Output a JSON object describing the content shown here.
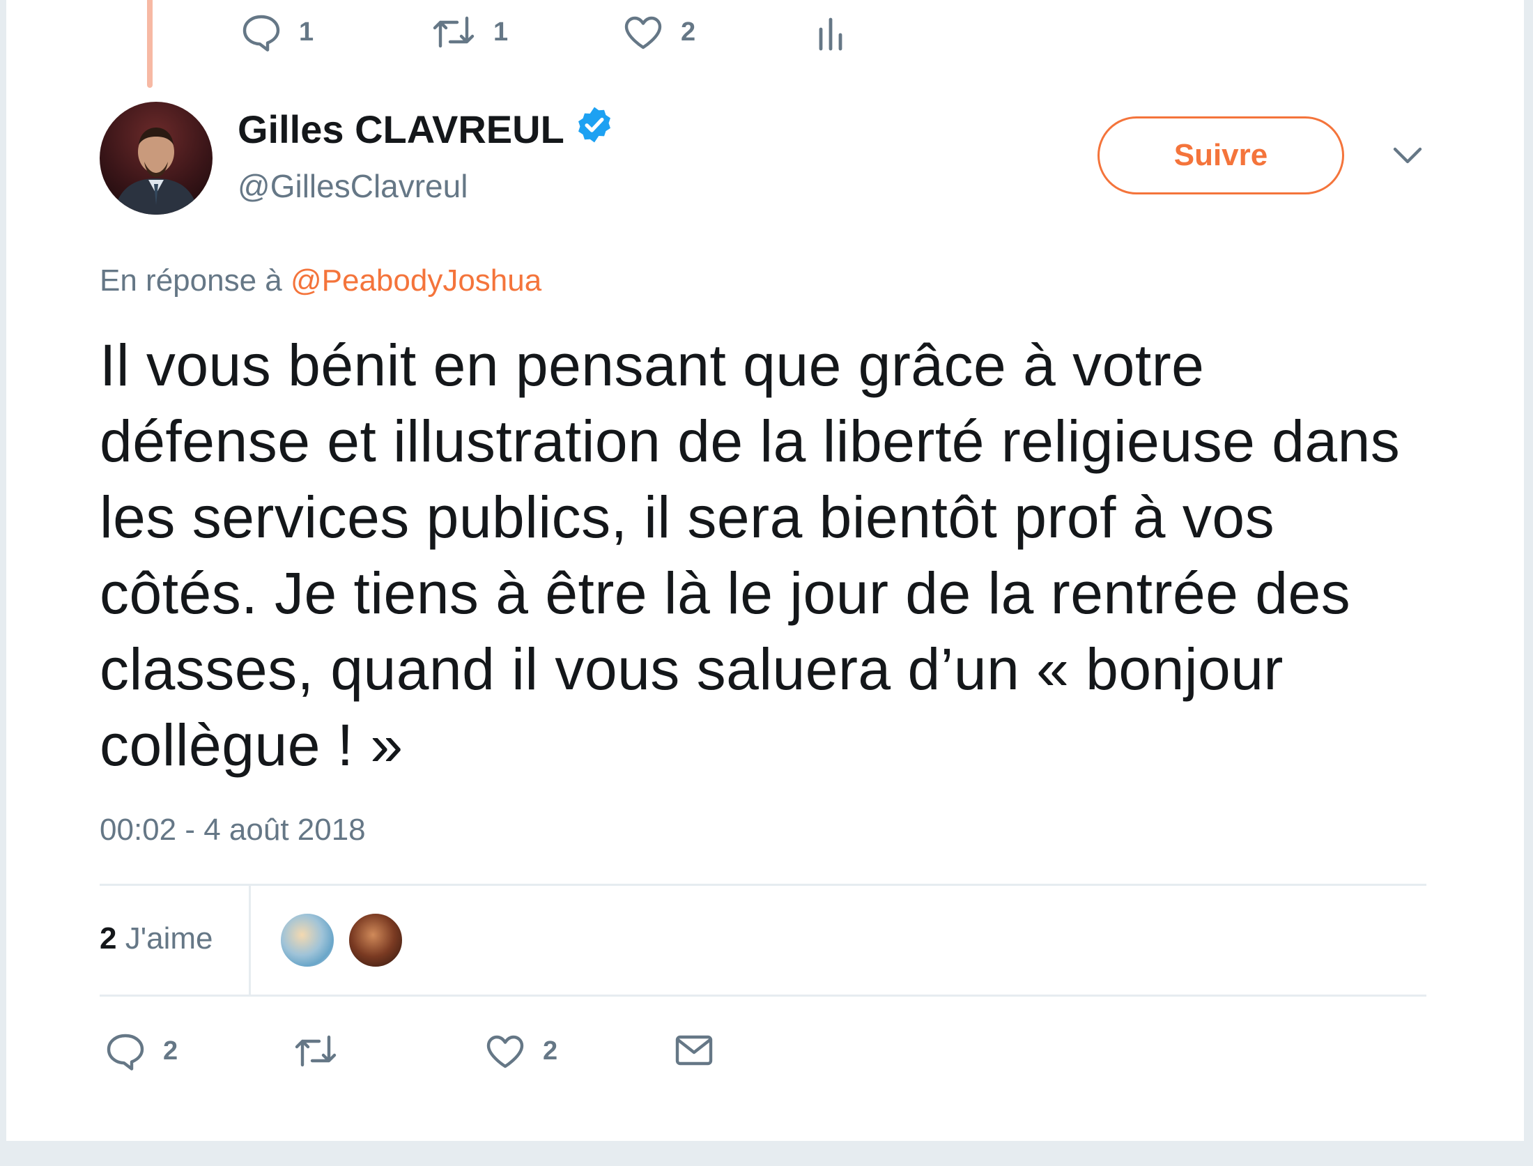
{
  "previous_tweet": {
    "actions": {
      "reply_count": "1",
      "retweet_count": "1",
      "like_count": "2"
    }
  },
  "tweet": {
    "author_name": "Gilles CLAVREUL",
    "author_handle": "@GillesClavreul",
    "verified": true,
    "follow_label": "Suivre",
    "reply_prefix": "En réponse à ",
    "reply_handle": "@PeabodyJoshua",
    "text": "Il vous bénit en pensant que grâce à votre défense et illustration de la liberté religieuse dans les services publics, il sera bientôt prof à vos côtés. Je tiens à être là le jour de la rentrée des classes, quand il vous saluera d’un « bonjour collègue ! »",
    "timestamp": "00:02 - 4 août 2018",
    "likes_count": "2",
    "likes_label": "J'aime",
    "actions": {
      "reply_count": "2",
      "like_count": "2"
    }
  },
  "colors": {
    "accent": "#f4743b",
    "verified": "#1da1f2",
    "muted": "#657786",
    "text": "#14171a"
  },
  "icons": [
    "reply-icon",
    "retweet-icon",
    "like-icon",
    "analytics-icon",
    "verified-badge-icon",
    "chevron-down-icon",
    "dm-envelope-icon"
  ]
}
